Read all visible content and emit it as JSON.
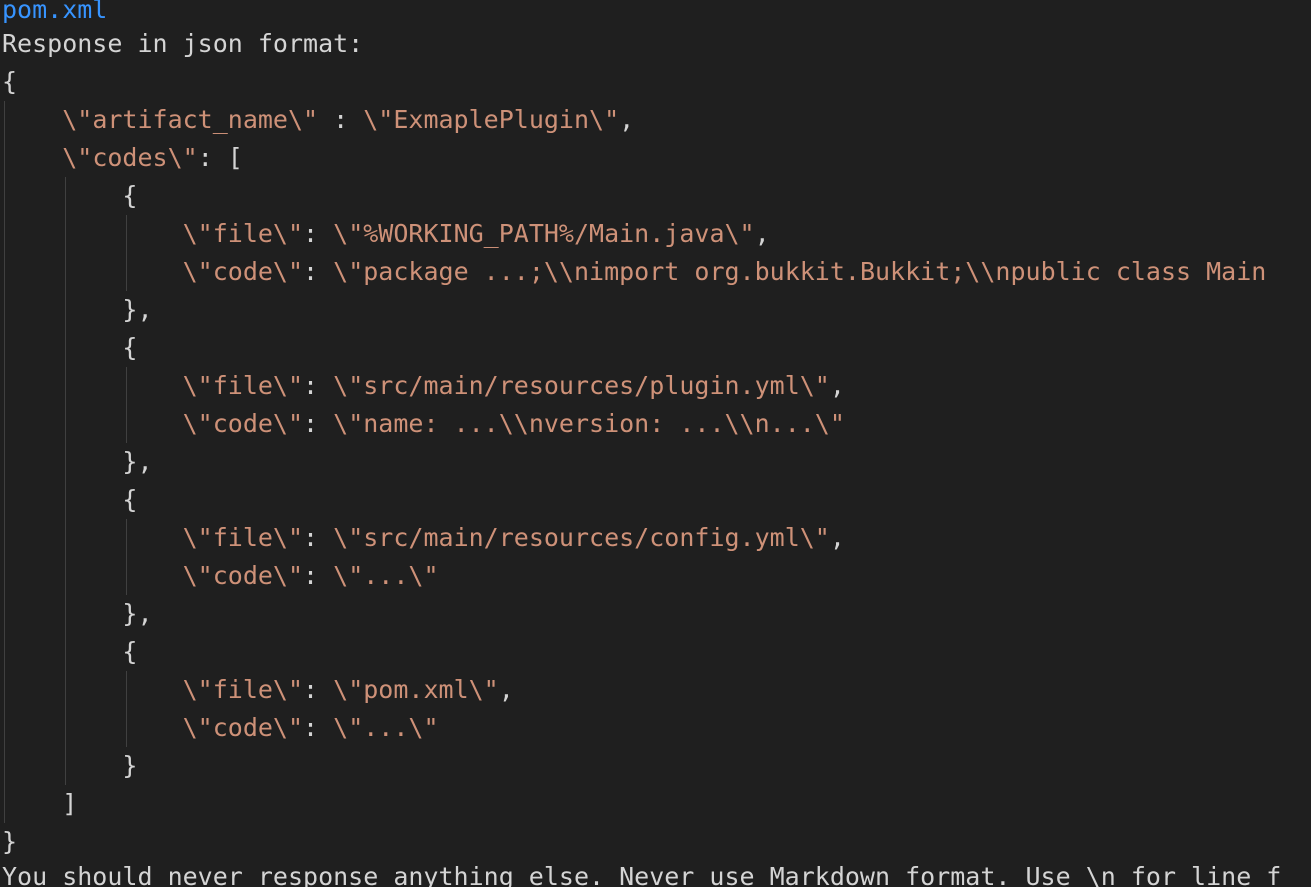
{
  "editor": {
    "top_line": "pom.xml",
    "header": "Response in json format:",
    "open_brace": "{",
    "artifact_indent": "    ",
    "artifact_key": "\\\"artifact_name\\\"",
    "artifact_sep": " : ",
    "artifact_value": "\\\"ExmaplePlugin\\\"",
    "artifact_comma": ",",
    "codes_indent": "    ",
    "codes_key": "\\\"codes\\\"",
    "codes_open": ": [",
    "entries": [
      {
        "open": "        {",
        "file_indent": "            ",
        "file_key": "\\\"file\\\"",
        "file_sep": ": ",
        "file_value": "\\\"%WORKING_PATH%/Main.java\\\"",
        "file_comma": ",",
        "code_indent": "            ",
        "code_key": "\\\"code\\\"",
        "code_sep": ": ",
        "code_value": "\\\"package ...;\\\\nimport org.bukkit.Bukkit;\\\\npublic class Main",
        "close": "        },"
      },
      {
        "open": "        {",
        "file_indent": "            ",
        "file_key": "\\\"file\\\"",
        "file_sep": ": ",
        "file_value": "\\\"src/main/resources/plugin.yml\\\"",
        "file_comma": ",",
        "code_indent": "            ",
        "code_key": "\\\"code\\\"",
        "code_sep": ": ",
        "code_value": "\\\"name: ...\\\\nversion: ...\\\\n...\\\"",
        "close": "        },"
      },
      {
        "open": "        {",
        "file_indent": "            ",
        "file_key": "\\\"file\\\"",
        "file_sep": ": ",
        "file_value": "\\\"src/main/resources/config.yml\\\"",
        "file_comma": ",",
        "code_indent": "            ",
        "code_key": "\\\"code\\\"",
        "code_sep": ": ",
        "code_value": "\\\"...\\\"",
        "close": "        },"
      },
      {
        "open": "        {",
        "file_indent": "            ",
        "file_key": "\\\"file\\\"",
        "file_sep": ": ",
        "file_value": "\\\"pom.xml\\\"",
        "file_comma": ",",
        "code_indent": "            ",
        "code_key": "\\\"code\\\"",
        "code_sep": ": ",
        "code_value": "\\\"...\\\"",
        "close": "        }"
      }
    ],
    "codes_close": "    ]",
    "close_brace": "}",
    "footer": "You should never response anything else. Never use Markdown format. Use \\n for line f"
  },
  "colors": {
    "background": "#1f1f1f",
    "text": "#d4d4d4",
    "string": "#ce9178",
    "link": "#3794ff",
    "indent_guide": "#404040"
  }
}
